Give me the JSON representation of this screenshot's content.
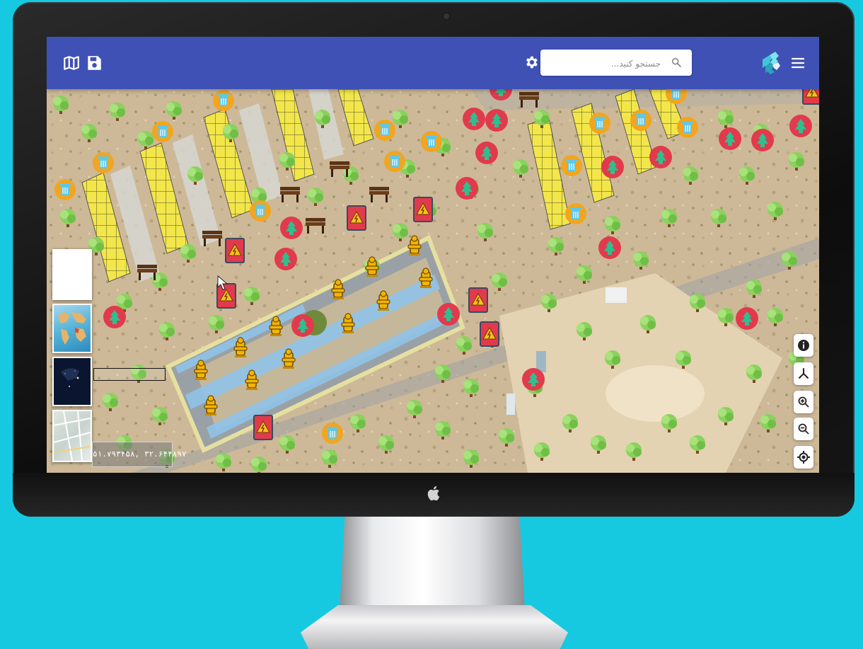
{
  "app": {
    "brand_color": "#3f51b5",
    "logo_icon": "puzzle-logo-icon"
  },
  "topbar": {
    "map_icon": "map-icon",
    "save_icon": "save-icon",
    "settings_icon": "gear-icon",
    "menu_icon": "hamburger-menu-icon",
    "search": {
      "placeholder": "جستجو کنید...",
      "icon": "search-icon"
    }
  },
  "basemaps": [
    {
      "name": "blank-basemap",
      "color": "#ffffff"
    },
    {
      "name": "world-map-basemap",
      "color": "#4aa3c9"
    },
    {
      "name": "night-earth-basemap",
      "color": "#0a1530"
    },
    {
      "name": "street-map-basemap",
      "color": "#cfd8cf"
    }
  ],
  "map": {
    "scale_label": "",
    "coordinates": "۵۱.۷۹۳۴۵۸, ۳۲.۶۴۴۸۹۷",
    "marker_types": {
      "tree": {
        "icon": "tree-icon",
        "color": "#e23a4d"
      },
      "trash_bin": {
        "icon": "trash-bin-icon",
        "color": "#f2a51f"
      },
      "electric_box": {
        "icon": "electric-hazard-icon",
        "color": "#e23a4d"
      },
      "bench": {
        "icon": "bench-icon",
        "color": "#4a2a14"
      },
      "fire_hydrant": {
        "icon": "fire-hydrant-icon",
        "color": "#f4b400"
      }
    }
  },
  "tools": [
    {
      "name": "info-button",
      "icon": "info-icon"
    },
    {
      "name": "measure-button",
      "icon": "measure-icon"
    },
    {
      "name": "zoom-in-button",
      "icon": "zoom-in-icon"
    },
    {
      "name": "zoom-out-button",
      "icon": "zoom-out-icon"
    },
    {
      "name": "locate-button",
      "icon": "locate-icon"
    }
  ]
}
